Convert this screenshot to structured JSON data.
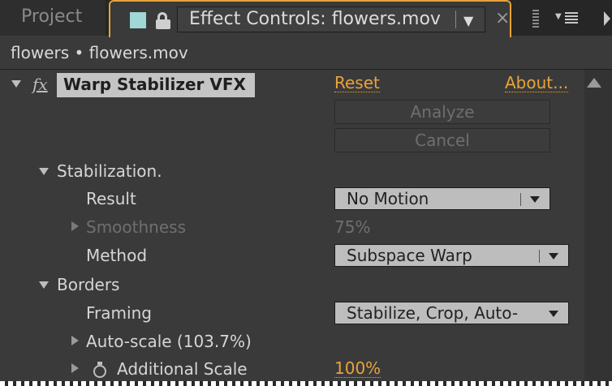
{
  "tabs": {
    "project": "Project",
    "active_title": "Effect Controls: flowers.mov"
  },
  "breadcrumb": "flowers • flowers.mov",
  "effect": {
    "name": "Warp Stabilizer VFX",
    "reset": "Reset",
    "about": "About..."
  },
  "buttons": {
    "analyze": "Analyze",
    "cancel": "Cancel"
  },
  "stabilization": {
    "group": "Stabilization.",
    "result_label": "Result",
    "result_value": "No Motion",
    "smoothness_label": "Smoothness",
    "smoothness_value": "75%",
    "method_label": "Method",
    "method_value": "Subspace Warp"
  },
  "borders": {
    "group": "Borders",
    "framing_label": "Framing",
    "framing_value": "Stabilize, Crop, Auto-",
    "autoscale_label": "Auto-scale (103.7%)",
    "additional_scale_label": "Additional Scale",
    "additional_scale_value": "100%"
  },
  "colors": {
    "accent": "#e8a33a",
    "panel_bg": "#3a3a3a"
  },
  "icons": [
    "grip-icon",
    "color-swatch-icon",
    "lock-icon",
    "dropdown-arrow-icon",
    "close-icon",
    "panel-menu-icon",
    "fx-icon",
    "disclosure-triangle-icon",
    "stopwatch-icon"
  ]
}
